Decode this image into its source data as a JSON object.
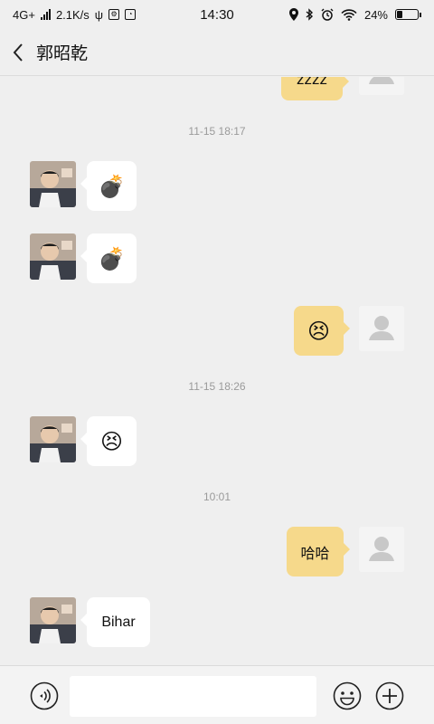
{
  "statusbar": {
    "network": "4G+",
    "speed": "2.1K/s",
    "time": "14:30",
    "battery": "24%",
    "battery_level": 0.24
  },
  "header": {
    "title": "郭昭乾",
    "back_icon": "chevron-left-icon"
  },
  "messages": [
    {
      "type": "out",
      "text": "zzzz"
    },
    {
      "type": "timestamp",
      "text": "11-15 18:17"
    },
    {
      "type": "in",
      "text": "💣"
    },
    {
      "type": "in",
      "text": "💣"
    },
    {
      "type": "out",
      "text": "😣"
    },
    {
      "type": "timestamp",
      "text": "11-15 18:26"
    },
    {
      "type": "in",
      "text": "😣"
    },
    {
      "type": "timestamp",
      "text": "10:01"
    },
    {
      "type": "out",
      "text": "哈哈"
    },
    {
      "type": "in",
      "text": "Bihar"
    }
  ],
  "composer": {
    "input_value": "",
    "voice_icon": "voice-icon",
    "emoji_icon": "emoji-icon",
    "plus_icon": "plus-icon"
  },
  "colors": {
    "background": "#efefef",
    "bubble_out": "#f6d98b",
    "bubble_in": "#ffffff"
  }
}
